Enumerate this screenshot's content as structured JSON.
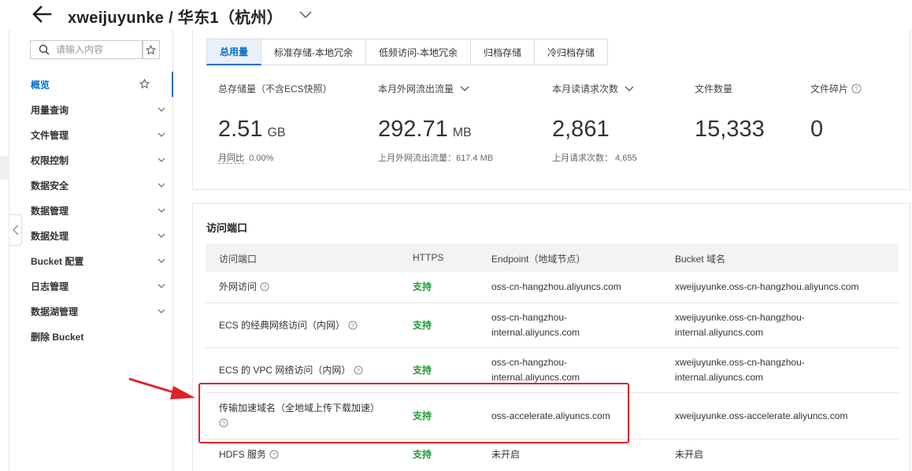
{
  "header": {
    "title": "xweijuyunke / 华东1（杭州）"
  },
  "sidebar": {
    "search_placeholder": "请输入内容",
    "items": [
      {
        "label": "概览",
        "active": true
      },
      {
        "label": "用量查询"
      },
      {
        "label": "文件管理"
      },
      {
        "label": "权限控制"
      },
      {
        "label": "数据安全"
      },
      {
        "label": "数据管理"
      },
      {
        "label": "数据处理"
      },
      {
        "label": "Bucket 配置"
      },
      {
        "label": "日志管理"
      },
      {
        "label": "数据湖管理"
      },
      {
        "label": "删除 Bucket"
      }
    ]
  },
  "tabs": [
    {
      "label": "总用量",
      "active": true
    },
    {
      "label": "标准存储-本地冗余"
    },
    {
      "label": "低频访问-本地冗余"
    },
    {
      "label": "归档存储"
    },
    {
      "label": "冷归档存储"
    }
  ],
  "stats": {
    "storage": {
      "label": "总存储量（不含ECS快照）",
      "value": "2.51",
      "unit": "GB",
      "sub_label": "月同比",
      "sub_value": "0.00%"
    },
    "traffic": {
      "label": "本月外网流出流量",
      "value": "292.71",
      "unit": "MB",
      "sub": "上月外网流出流量：617.4 MB"
    },
    "requests": {
      "label": "本月读请求次数",
      "value": "2,861",
      "sub": "上月请求次数： 4,655"
    },
    "files": {
      "label": "文件数量",
      "value": "15,333"
    },
    "fragments": {
      "label": "文件碎片",
      "value": "0"
    }
  },
  "access": {
    "title": "访问端口",
    "columns": [
      "访问端口",
      "HTTPS",
      "Endpoint（地域节点）",
      "Bucket 域名"
    ],
    "rows": [
      {
        "name": "外网访问",
        "https": "支持",
        "endpoint": "oss-cn-hangzhou.aliyuncs.com",
        "bucket": "xweijuyunke.oss-cn-hangzhou.aliyuncs.com"
      },
      {
        "name": "ECS 的经典网络访问（内网）",
        "https": "支持",
        "endpoint_1": "oss-cn-hangzhou-",
        "endpoint_2": "internal.aliyuncs.com",
        "bucket_1": "xweijuyunke.oss-cn-hangzhou-",
        "bucket_2": "internal.aliyuncs.com"
      },
      {
        "name": "ECS 的 VPC 网络访问（内网）",
        "https": "支持",
        "endpoint_1": "oss-cn-hangzhou-",
        "endpoint_2": "internal.aliyuncs.com",
        "bucket_1": "xweijuyunke.oss-cn-hangzhou-",
        "bucket_2": "internal.aliyuncs.com"
      },
      {
        "name": "传输加速域名（全地域上传下载加速）",
        "https": "支持",
        "endpoint": "oss-accelerate.aliyuncs.com",
        "bucket": "xweijuyunke.oss-accelerate.aliyuncs.com"
      },
      {
        "name": "HDFS 服务",
        "https": "支持",
        "endpoint": "未开启",
        "bucket": "未开启"
      }
    ]
  },
  "colors": {
    "accent": "#0070cc",
    "support_green": "#1e9a37",
    "highlight_red": "#e0202a"
  }
}
